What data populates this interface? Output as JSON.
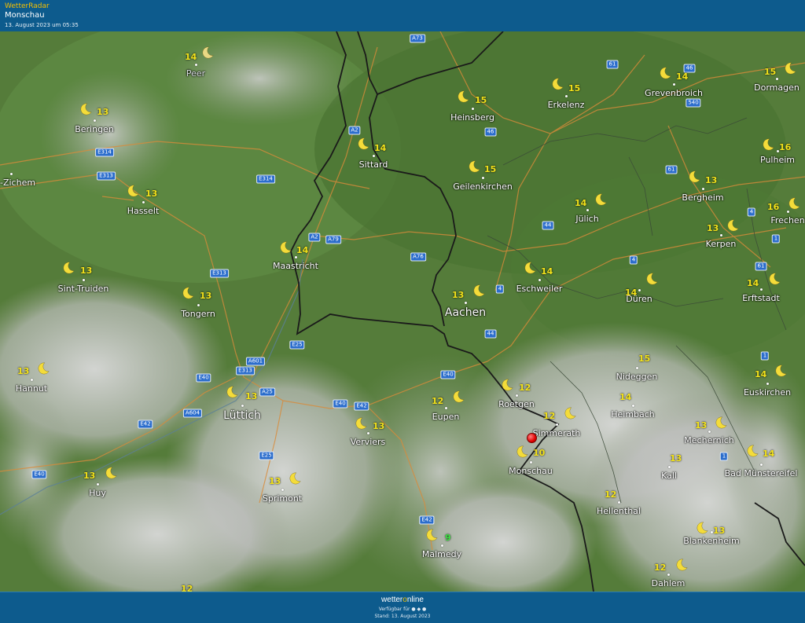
{
  "header": {
    "brand": "WetterRadar",
    "location": "Monschau",
    "timestamp": "13. August 2023 um 05:35"
  },
  "footer": {
    "logo_a": "wetter",
    "logo_o": "o",
    "logo_b": "nline",
    "available": "Verfügbar für ● ◆ ●",
    "stand": "Stand: 13. August 2023"
  },
  "colors": {
    "header_bg": "#0d5b8d",
    "temp_yellow": "#f3e21a",
    "temp_green": "#39e13f",
    "border": "#1a1a1a",
    "road_orange": "#d98b3a",
    "road_shield": "#2b6dcc",
    "marker": "#e00000"
  },
  "cities": [
    {
      "name": "Peer",
      "temp": "14",
      "dim": true
    },
    {
      "name": "Beringen",
      "temp": "13"
    },
    {
      "name": "-Zichem",
      "temp": ""
    },
    {
      "name": "Hasselt",
      "temp": "13"
    },
    {
      "name": "Sint-Truiden",
      "temp": "13"
    },
    {
      "name": "Tongern",
      "temp": "13"
    },
    {
      "name": "Hannut",
      "temp": "13"
    },
    {
      "name": "Huy",
      "temp": "13"
    },
    {
      "name": "Lüttich",
      "temp": "13",
      "big": true
    },
    {
      "name": "Maastricht",
      "temp": "14"
    },
    {
      "name": "Sittard",
      "temp": "14"
    },
    {
      "name": "Heinsberg",
      "temp": "15"
    },
    {
      "name": "Erkelenz",
      "temp": "15"
    },
    {
      "name": "Grevenbroich",
      "temp": "14"
    },
    {
      "name": "Dormagen",
      "temp": "15"
    },
    {
      "name": "Geilenkirchen",
      "temp": "15"
    },
    {
      "name": "Pulheim",
      "temp": "16"
    },
    {
      "name": "Bergheim",
      "temp": "13"
    },
    {
      "name": "Jülich",
      "temp": "14"
    },
    {
      "name": "Frechen",
      "temp": "16"
    },
    {
      "name": "Kerpen",
      "temp": "13"
    },
    {
      "name": "Eschweiler",
      "temp": "14"
    },
    {
      "name": "Aachen",
      "temp": "13",
      "big": true
    },
    {
      "name": "Düren",
      "temp": "14"
    },
    {
      "name": "Erftstadt",
      "temp": "14"
    },
    {
      "name": "Nideggen",
      "temp": "15"
    },
    {
      "name": "Euskirchen",
      "temp": "14"
    },
    {
      "name": "Heimbach",
      "temp": "14"
    },
    {
      "name": "Roetgen",
      "temp": "12"
    },
    {
      "name": "Eupen",
      "temp": "12"
    },
    {
      "name": "Simmerath",
      "temp": "12"
    },
    {
      "name": "Mechernich",
      "temp": "13"
    },
    {
      "name": "Verviers",
      "temp": "13"
    },
    {
      "name": "Monschau",
      "temp": "10"
    },
    {
      "name": "Kall",
      "temp": "13"
    },
    {
      "name": "Bad Münstereifel",
      "temp": "14"
    },
    {
      "name": "Sprimont",
      "temp": "13"
    },
    {
      "name": "Hellenthal",
      "temp": "12"
    },
    {
      "name": "Malmedy",
      "temp": "9",
      "green": true
    },
    {
      "name": "Blankenheim",
      "temp": "13"
    },
    {
      "name": "Dahlem",
      "temp": "12"
    },
    {
      "name": "",
      "temp": "12"
    }
  ],
  "roads": [
    "A73",
    "61",
    "46",
    "540",
    "A2",
    "46",
    "E314",
    "E313",
    "E314",
    "61",
    "A2",
    "A79",
    "A76",
    "44",
    "4",
    "1",
    "E313",
    "4",
    "61",
    "4",
    "E25",
    "A601",
    "E313",
    "E40",
    "A25",
    "E40",
    "E40",
    "E42",
    "44",
    "A604",
    "E42",
    "E40",
    "E25",
    "E42",
    "1",
    "1",
    "E42"
  ],
  "marker": {
    "label": "Monschau"
  },
  "icons": {
    "weather": "crescent-moon-icon",
    "marker": "location-pin-icon"
  }
}
